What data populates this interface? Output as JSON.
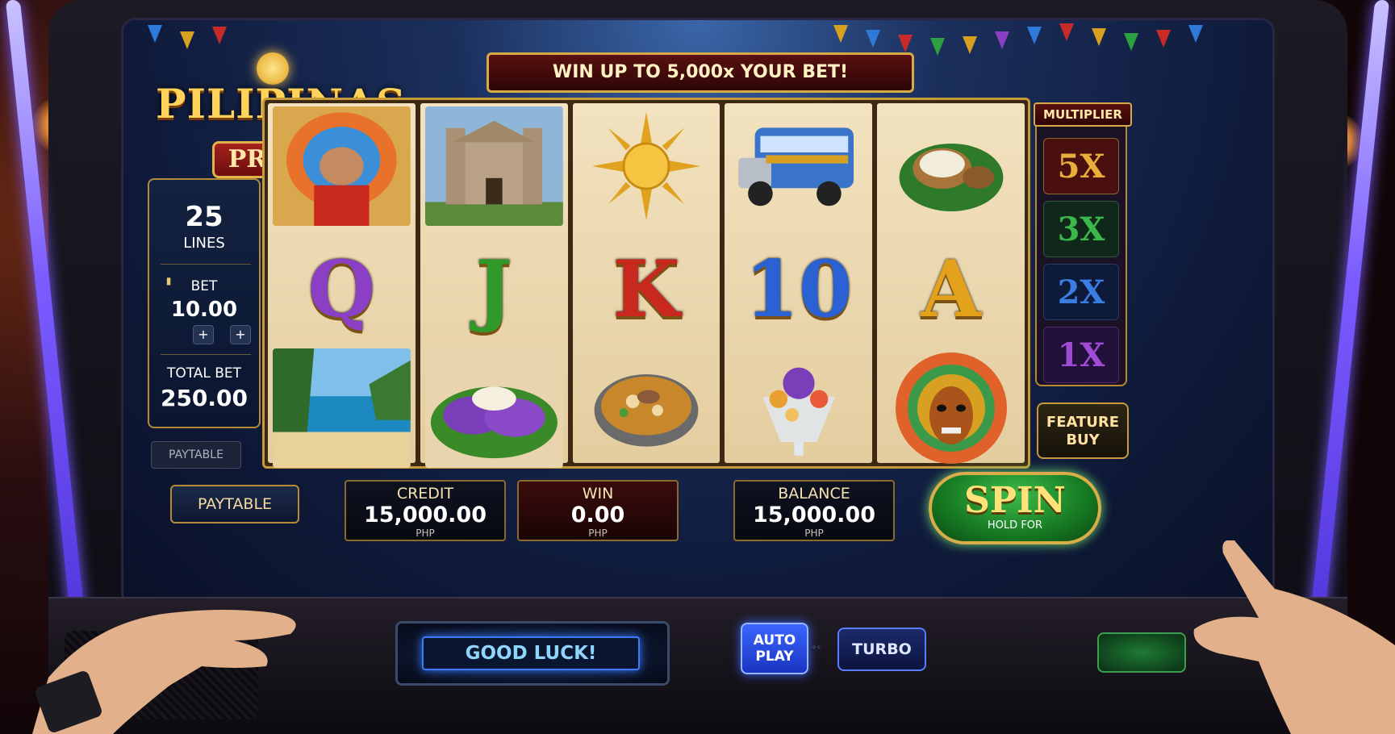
{
  "game": {
    "title": "PILIPINAS",
    "subtitle": "PRIDE",
    "banner": "WIN UP TO 5,000x YOUR BET!"
  },
  "bet_panel": {
    "lines_value": "25",
    "lines_label": "LINES",
    "bet_label": "BET",
    "bet_value": "10.00",
    "plus_label": "+",
    "total_bet_label": "TOTAL BET",
    "total_bet_value": "250.00",
    "paytable_ghost": "PAYTABLE"
  },
  "reels": [
    {
      "top": "dancer-icon",
      "mid": "Q",
      "mid_color": "#8a3fc4",
      "bot": "beach-icon"
    },
    {
      "top": "church-icon",
      "mid": "J",
      "mid_color": "#2f9a2a",
      "bot": "ube-cake-icon"
    },
    {
      "top": "sun-icon",
      "mid": "K",
      "mid_color": "#c8281e",
      "bot": "soup-bowl-icon"
    },
    {
      "top": "jeepney-icon",
      "mid": "10",
      "mid_color": "#2a62d4",
      "bot": "halo-halo-icon"
    },
    {
      "top": "bibingka-icon",
      "mid": "A",
      "mid_color": "#e3a21c",
      "bot": "festival-mask-icon"
    }
  ],
  "multiplier": {
    "title": "MULTIPLIER",
    "levels": [
      {
        "label": "5X",
        "color": "#e8b03a",
        "bg": "#4a1010"
      },
      {
        "label": "3X",
        "color": "#3cb84a",
        "bg": "#10281a"
      },
      {
        "label": "2X",
        "color": "#3a7ce0",
        "bg": "#0e1a3a"
      },
      {
        "label": "1X",
        "color": "#a04ad8",
        "bg": "#22103a"
      }
    ]
  },
  "feature_buy": {
    "line1": "FEATURE",
    "line2": "BUY"
  },
  "paytable_button": "PAYTABLE",
  "meters": {
    "credit": {
      "label": "CREDIT",
      "value": "15,000.00",
      "currency": "PHP"
    },
    "win": {
      "label": "WIN",
      "value": "0.00",
      "currency": "PHP"
    },
    "balance": {
      "label": "BALANCE",
      "value": "15,000.00",
      "currency": "PHP"
    }
  },
  "spin": {
    "label": "SPIN",
    "sub": "HOLD FOR"
  },
  "console": {
    "message": "GOOD LUCK!",
    "autoplay_line1": "AUTO",
    "autoplay_line2": "PLAY",
    "turbo": "TURBO"
  },
  "colors": {
    "gold": "#d7aa45",
    "screen_blue": "#1b2f5c",
    "spin_green": "#167a22",
    "neon_purple": "#7b5cff"
  }
}
